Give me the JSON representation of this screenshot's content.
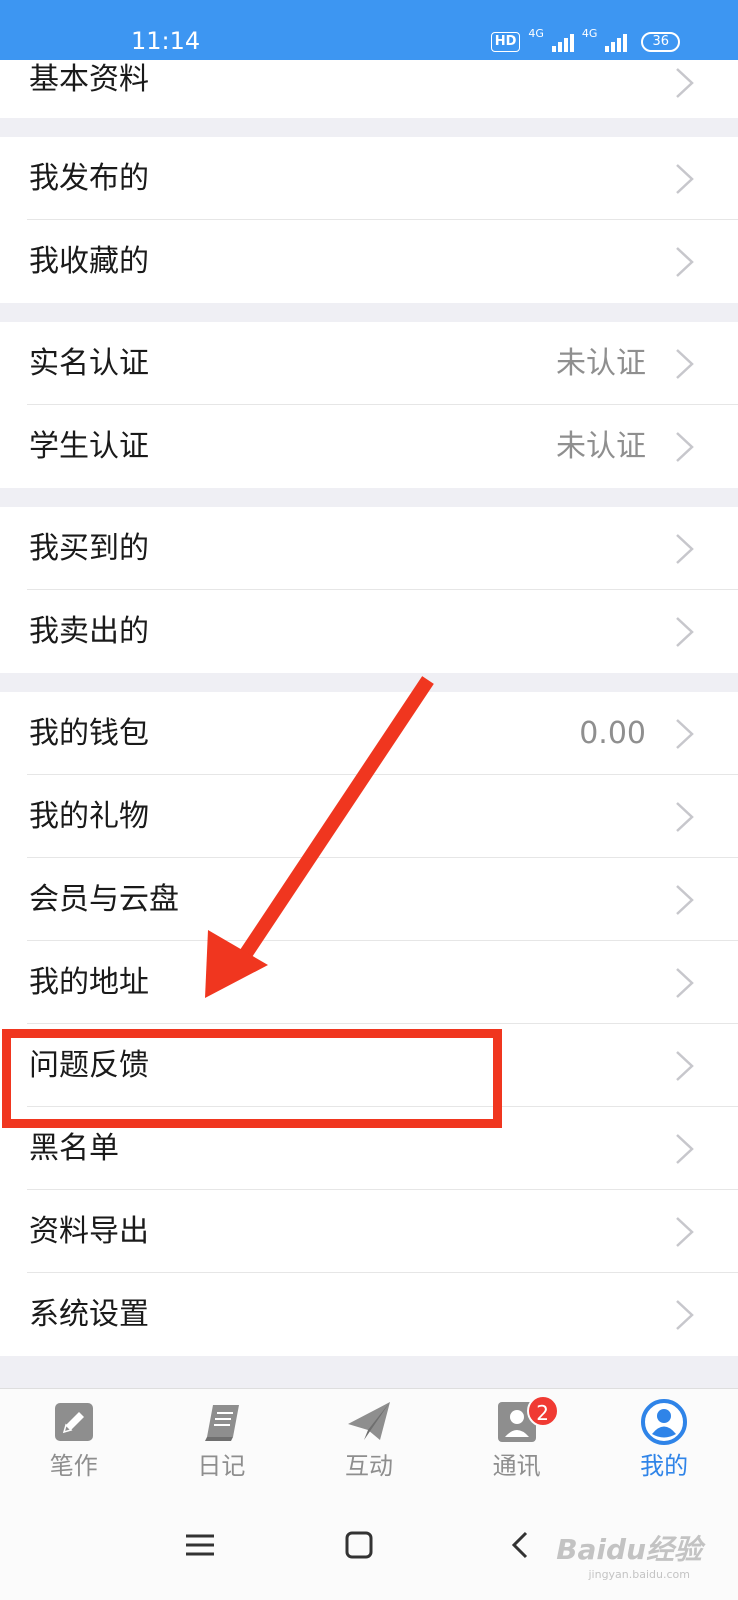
{
  "status_bar": {
    "time": "11:14",
    "hd": "HD",
    "net1": "4G",
    "net2": "4G",
    "battery": "36"
  },
  "menu_groups": [
    {
      "items": [
        {
          "label": "基本资料",
          "value": ""
        }
      ]
    },
    {
      "items": [
        {
          "label": "我发布的",
          "value": ""
        },
        {
          "label": "我收藏的",
          "value": ""
        }
      ]
    },
    {
      "items": [
        {
          "label": "实名认证",
          "value": "未认证"
        },
        {
          "label": "学生认证",
          "value": "未认证"
        }
      ]
    },
    {
      "items": [
        {
          "label": "我买到的",
          "value": ""
        },
        {
          "label": "我卖出的",
          "value": ""
        }
      ]
    },
    {
      "items": [
        {
          "label": "我的钱包",
          "value": "0.00"
        },
        {
          "label": "我的礼物",
          "value": ""
        },
        {
          "label": "会员与云盘",
          "value": ""
        },
        {
          "label": "我的地址",
          "value": ""
        },
        {
          "label": "问题反馈",
          "value": ""
        },
        {
          "label": "黑名单",
          "value": ""
        },
        {
          "label": "资料导出",
          "value": ""
        },
        {
          "label": "系统设置",
          "value": ""
        }
      ]
    }
  ],
  "tabs": [
    {
      "label": "笔作",
      "icon": "pencil-icon",
      "active": false
    },
    {
      "label": "日记",
      "icon": "notebook-icon",
      "active": false
    },
    {
      "label": "互动",
      "icon": "paper-plane-icon",
      "active": false
    },
    {
      "label": "通讯",
      "icon": "contacts-icon",
      "active": false,
      "badge": "2"
    },
    {
      "label": "我的",
      "icon": "profile-icon",
      "active": true
    }
  ],
  "colors": {
    "accent": "#2f84e8",
    "status_bar": "#3d96f2",
    "annotation": "#f0361f",
    "badge": "#f03a33"
  },
  "watermark": {
    "text": "Baidu经验",
    "sub": "jingyan.baidu.com"
  }
}
